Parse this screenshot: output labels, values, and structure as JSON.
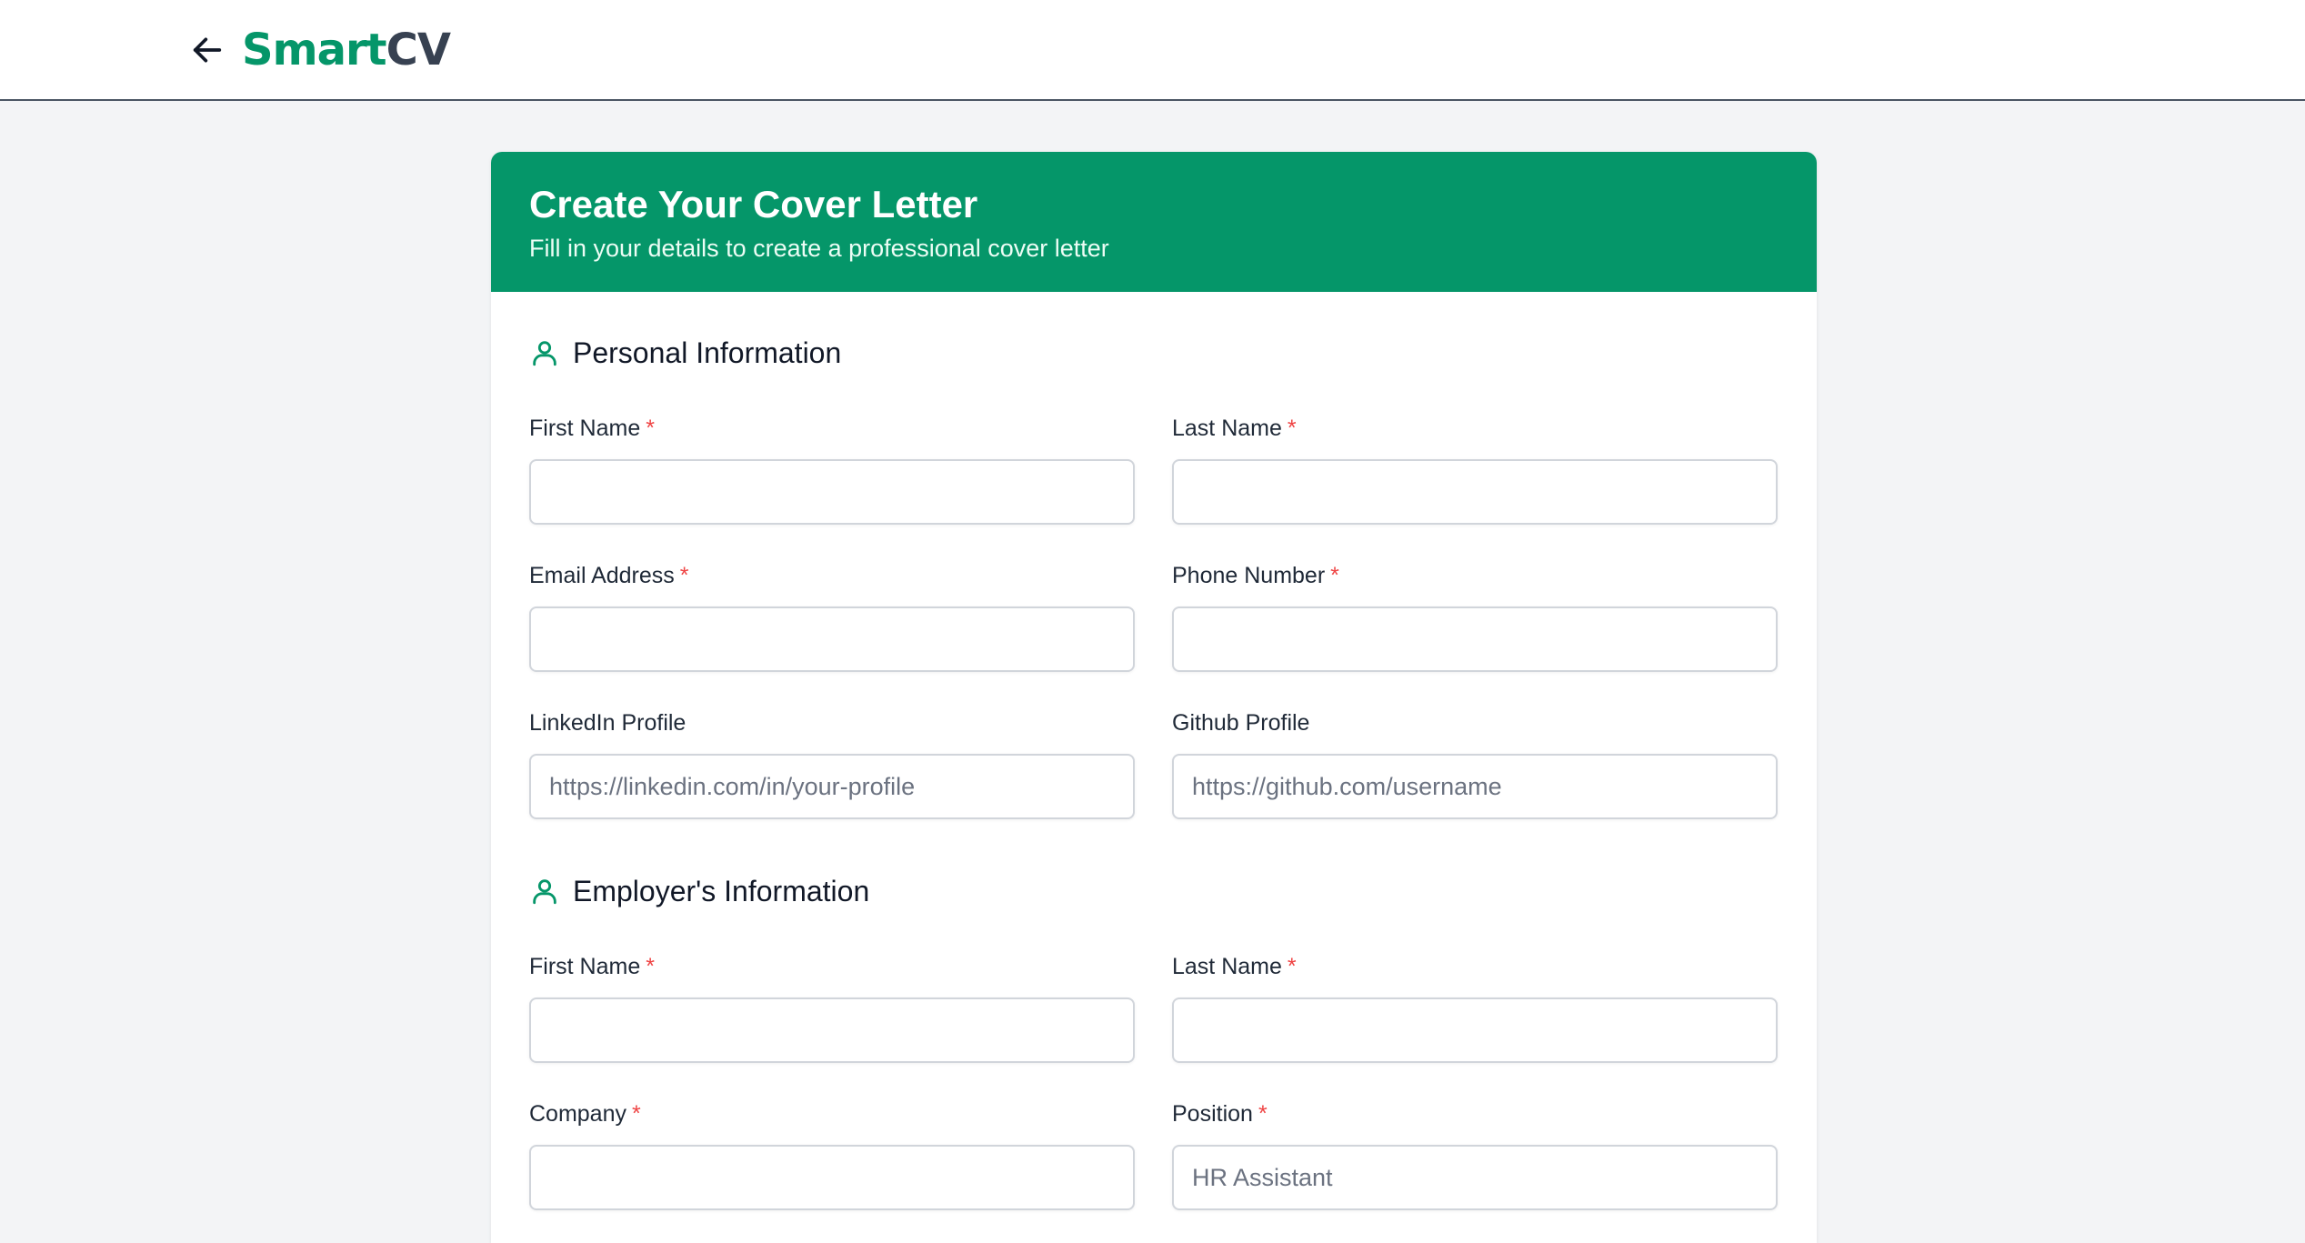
{
  "app": {
    "brand_part1": "Smart",
    "brand_part2": "CV",
    "brand_color": "#059669"
  },
  "icons": {
    "back": "arrow-left-icon",
    "section": "user-icon"
  },
  "header": {
    "title": "Create Your Cover Letter",
    "subtitle": "Fill in your details to create a professional cover letter"
  },
  "personal": {
    "title": "Personal Information",
    "first_name": {
      "label": "First Name",
      "required": "*",
      "value": "",
      "placeholder": ""
    },
    "last_name": {
      "label": "Last Name",
      "required": "*",
      "value": "",
      "placeholder": ""
    },
    "email": {
      "label": "Email Address",
      "required": "*",
      "value": "",
      "placeholder": ""
    },
    "phone": {
      "label": "Phone Number",
      "required": "*",
      "value": "",
      "placeholder": ""
    },
    "linkedin": {
      "label": "LinkedIn Profile",
      "value": "",
      "placeholder": "https://linkedin.com/in/your-profile"
    },
    "github": {
      "label": "Github Profile",
      "value": "",
      "placeholder": "https://github.com/username"
    }
  },
  "employer": {
    "title": "Employer's Information",
    "first_name": {
      "label": "First Name",
      "required": "*",
      "value": "",
      "placeholder": ""
    },
    "last_name": {
      "label": "Last Name",
      "required": "*",
      "value": "",
      "placeholder": ""
    },
    "company": {
      "label": "Company",
      "required": "*",
      "value": "",
      "placeholder": ""
    },
    "position": {
      "label": "Position",
      "required": "*",
      "value": "",
      "placeholder": "HR Assistant"
    }
  }
}
